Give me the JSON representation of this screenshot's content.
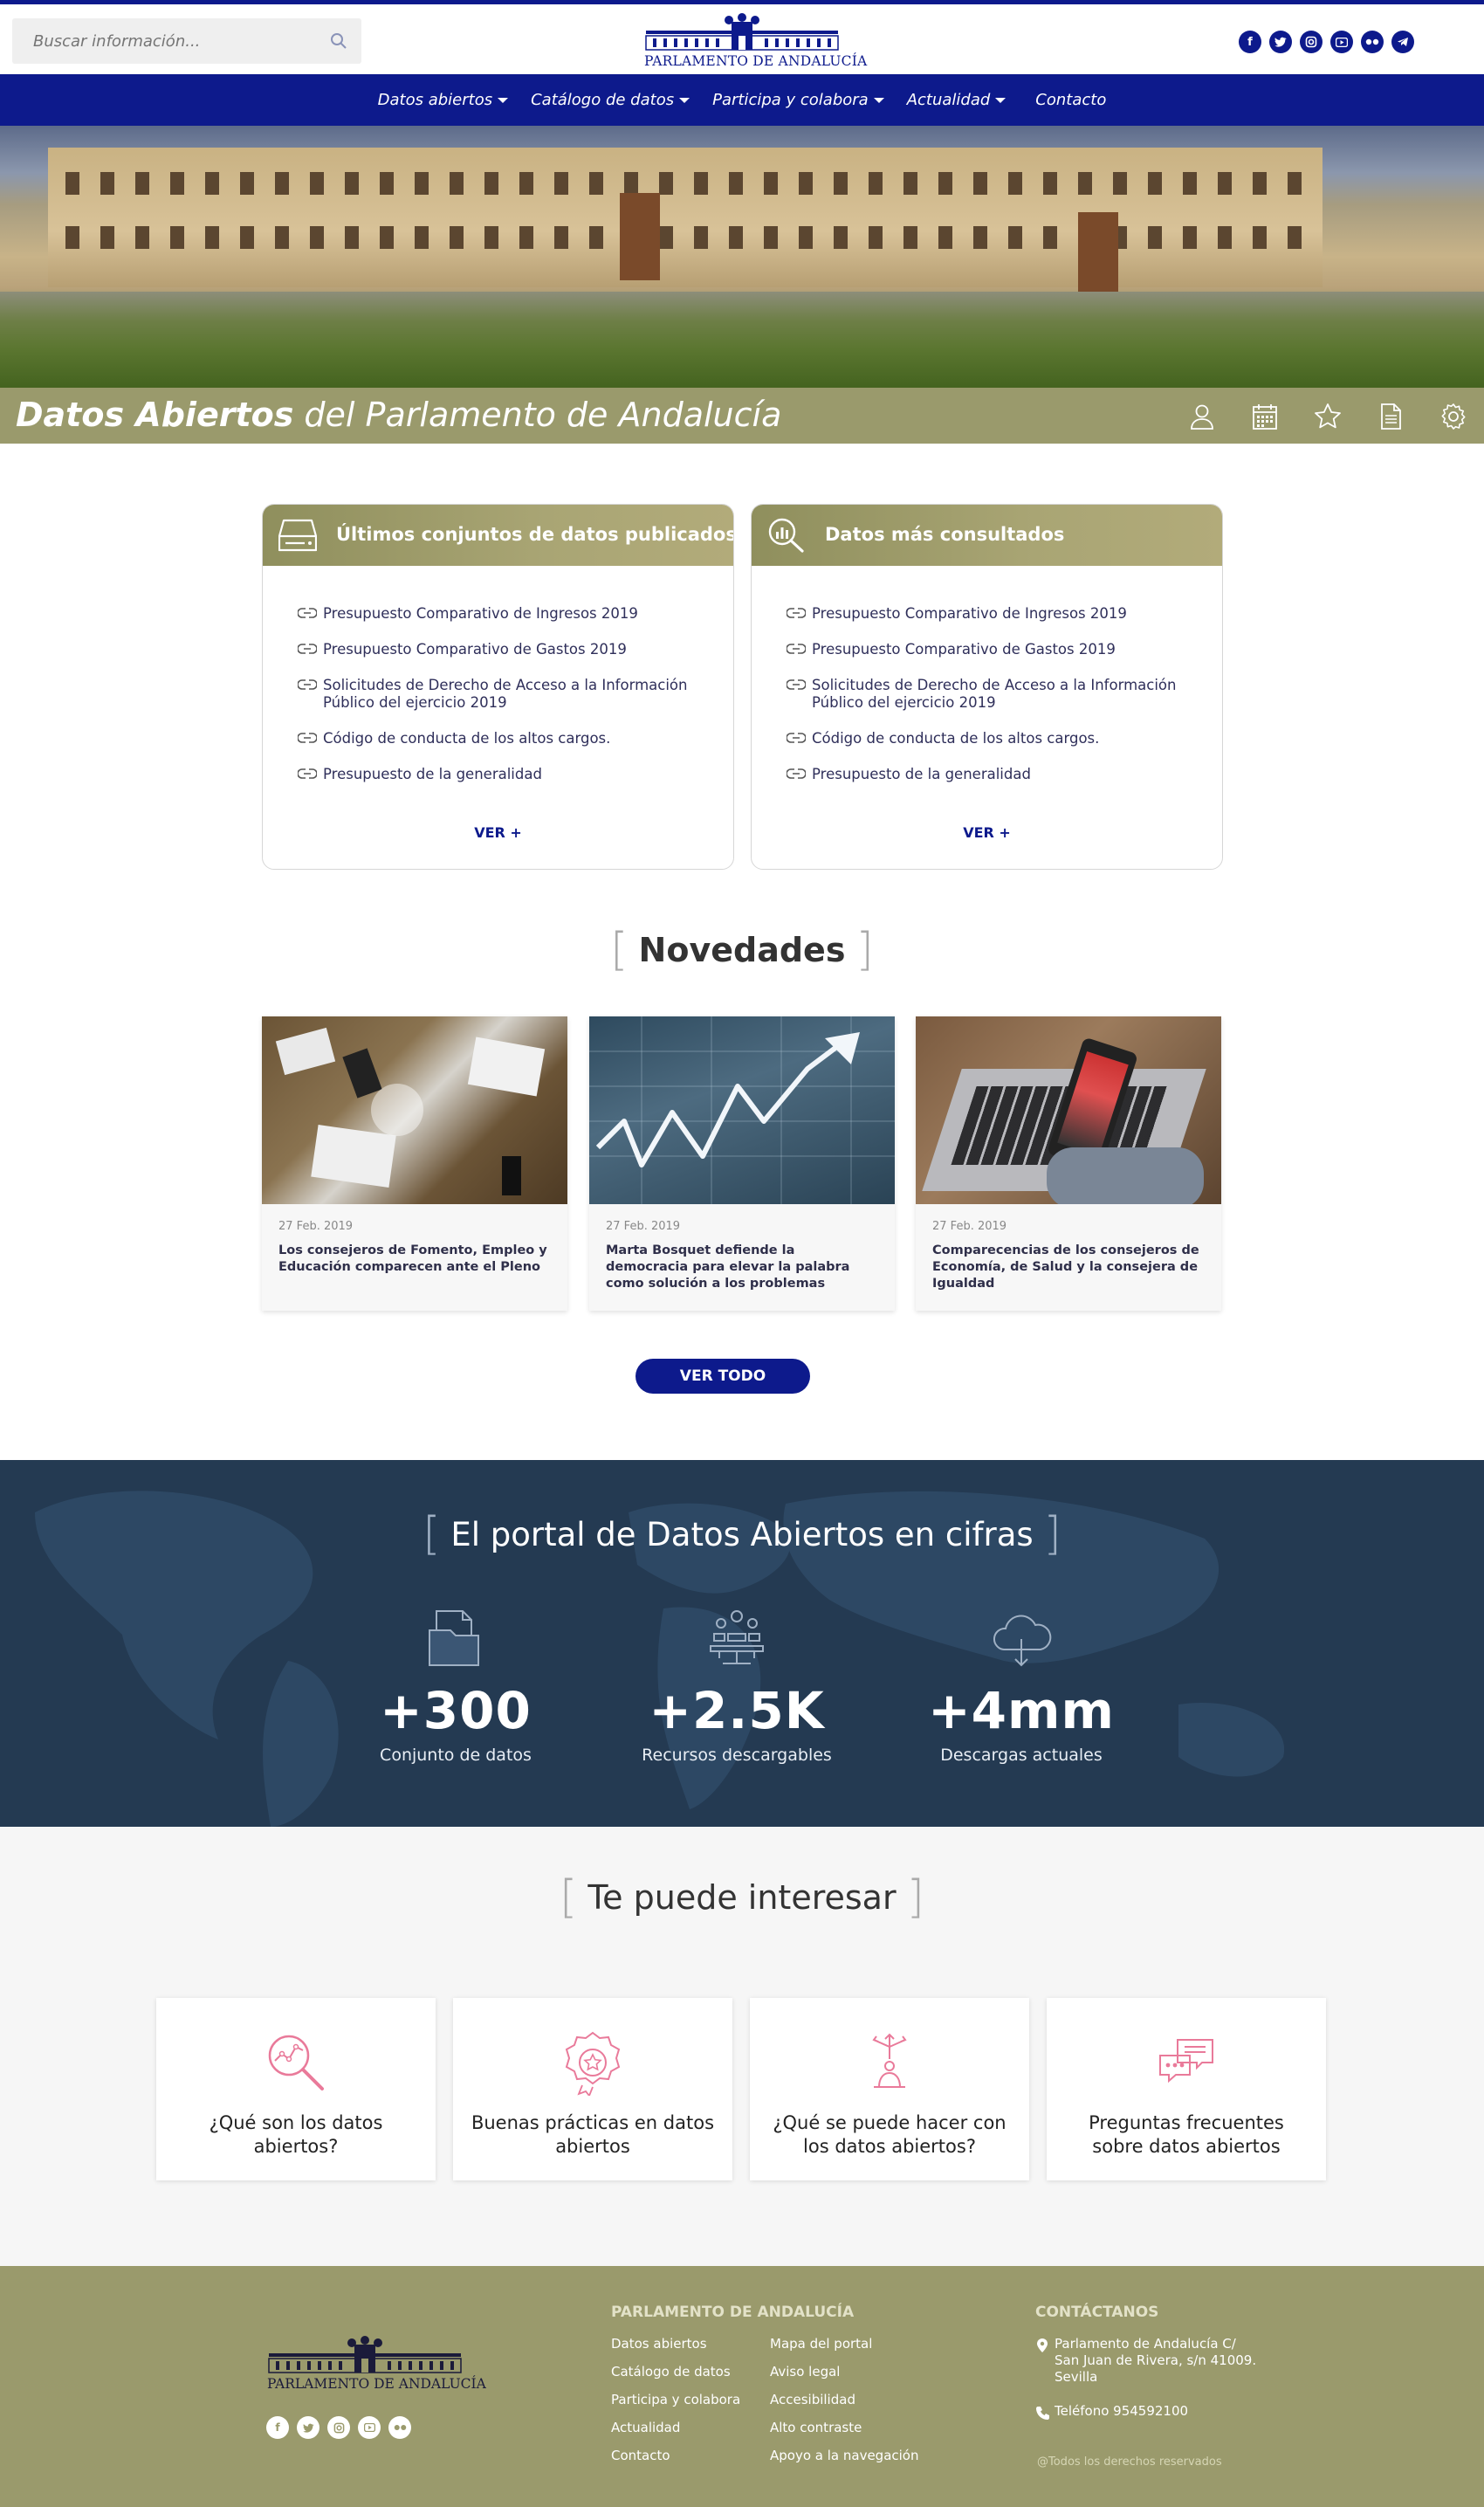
{
  "header": {
    "search_placeholder": "Buscar información...",
    "logo_text": "PARLAMENTO DE ANDALUCÍA",
    "socials": [
      "facebook-icon",
      "twitter-icon",
      "instagram-icon",
      "youtube-icon",
      "flickr-icon",
      "telegram-icon"
    ]
  },
  "nav": {
    "items": [
      {
        "label": "Datos abiertos",
        "has_dropdown": true
      },
      {
        "label": "Catálogo de datos",
        "has_dropdown": true
      },
      {
        "label": "Participa y colabora",
        "has_dropdown": true
      },
      {
        "label": "Actualidad",
        "has_dropdown": true
      },
      {
        "label": "Contacto",
        "has_dropdown": false
      }
    ]
  },
  "banner": {
    "title_bold": "Datos Abiertos",
    "title_rest": " del Parlamento de Andalucía",
    "icons": [
      "user-icon",
      "calendar-icon",
      "star-icon",
      "document-icon",
      "settings-icon"
    ]
  },
  "latest": {
    "title": "Últimos conjuntos de datos publicados",
    "items": [
      "Presupuesto Comparativo de Ingresos 2019",
      "Presupuesto Comparativo de Gastos 2019",
      "Solicitudes de Derecho de Acceso a la Información Público del ejercicio 2019",
      "Código de conducta de los altos cargos.",
      "Presupuesto de la generalidad"
    ],
    "more": "VER +"
  },
  "popular": {
    "title": "Datos más consultados",
    "items": [
      "Presupuesto Comparativo de Ingresos 2019",
      "Presupuesto Comparativo de Gastos 2019",
      "Solicitudes de Derecho de Acceso a la Información Público del ejercicio 2019",
      "Código de conducta de los altos cargos.",
      "Presupuesto de la generalidad"
    ],
    "more": "VER +"
  },
  "news": {
    "title": "Novedades",
    "items": [
      {
        "date": "27 Feb. 2019",
        "title": "Los consejeros de Fomento, Empleo y Educación comparecen ante el Pleno"
      },
      {
        "date": "27 Feb. 2019",
        "title": "Marta Bosquet defiende la democracia para elevar la palabra como solución a los problemas"
      },
      {
        "date": "27 Feb. 2019",
        "title": "Comparecencias de los consejeros de Economía, de Salud y la consejera de Igualdad"
      }
    ],
    "all_button": "VER TODO"
  },
  "stats": {
    "title": "El portal de Datos Abiertos en cifras",
    "items": [
      {
        "value": "+300",
        "label": "Conjunto de datos",
        "icon": "files-icon"
      },
      {
        "value": "+2.5K",
        "label": "Recursos descargables",
        "icon": "network-icon"
      },
      {
        "value": "+4mm",
        "label": "Descargas actuales",
        "icon": "cloud-download-icon"
      }
    ]
  },
  "interest": {
    "title": "Te puede interesar",
    "items": [
      {
        "label": "¿Qué son los datos abiertos?",
        "icon": "magnifier-chart-icon"
      },
      {
        "label": "Buenas prácticas en datos abiertos",
        "icon": "badge-star-icon"
      },
      {
        "label": "¿Qué se puede hacer con los datos abiertos?",
        "icon": "person-arrows-icon"
      },
      {
        "label": "Preguntas frecuentes sobre datos abiertos",
        "icon": "chat-bubbles-icon"
      }
    ]
  },
  "footer": {
    "logo_text": "PARLAMENTO DE ANDALUCÍA",
    "col1_title": "PARLAMENTO DE ANDALUCÍA",
    "col1": [
      "Datos abiertos",
      "Catálogo de datos",
      "Participa y colabora",
      "Actualidad",
      "Contacto"
    ],
    "col2": [
      "Mapa del portal",
      "Aviso legal",
      "Accesibilidad",
      "Alto contraste",
      "Apoyo a la navegación"
    ],
    "contact_title": "CONTÁCTANOS",
    "address": "Parlamento de Andalucía C/ San Juan de Rivera, s/n 41009. Sevilla",
    "phone": "Teléfono 954592100",
    "rights": "@Todos los derechos reservados"
  },
  "colors": {
    "primary": "#0d1a8c",
    "olive": "#9a9a6c",
    "dark_band": "#243a52",
    "pink": "#e97a9a"
  }
}
